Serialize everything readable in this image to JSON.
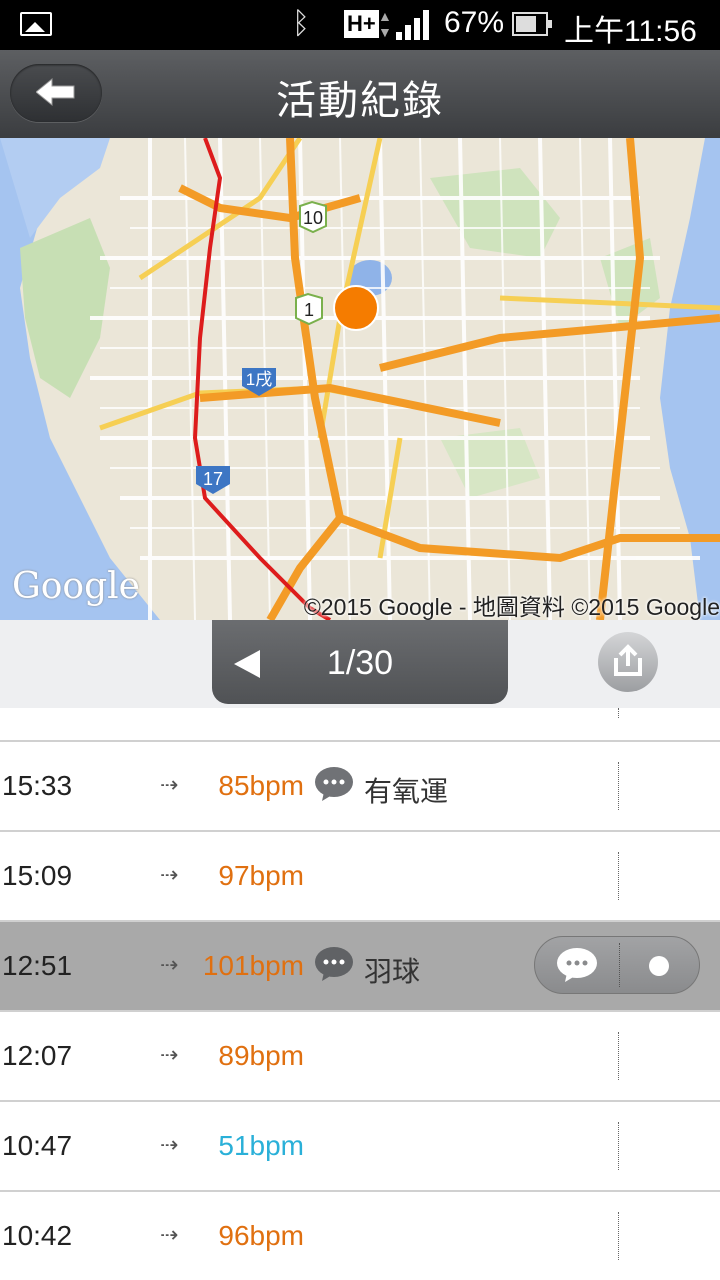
{
  "status_bar": {
    "network": "H+",
    "battery": "67%",
    "time": "上午11:56"
  },
  "header": {
    "title": "活動紀錄",
    "back_icon": "arrow-left-icon"
  },
  "map": {
    "logo": "Google",
    "copyright": "©2015 Google - 地圖資料 ©2015 Google",
    "markers": [
      "10",
      "1",
      "1戌",
      "17"
    ]
  },
  "pager": {
    "label": "1/30",
    "prev_icon": "triangle-left-icon",
    "share_icon": "share-icon"
  },
  "records": [
    {
      "time": "15:33",
      "bpm": "85bpm",
      "note": "有氧運",
      "has_note": true,
      "color": "#e07010"
    },
    {
      "time": "15:09",
      "bpm": "97bpm",
      "note": "",
      "has_note": false,
      "color": "#e07010"
    },
    {
      "time": "12:51",
      "bpm": "101bpm",
      "note": "羽球",
      "has_note": true,
      "color": "#e07010",
      "selected": true
    },
    {
      "time": "12:07",
      "bpm": "89bpm",
      "note": "",
      "has_note": false,
      "color": "#e07010"
    },
    {
      "time": "10:47",
      "bpm": "51bpm",
      "note": "",
      "has_note": false,
      "color": "#2ab0d8"
    },
    {
      "time": "10:42",
      "bpm": "96bpm",
      "note": "",
      "has_note": false,
      "color": "#e07010"
    }
  ]
}
